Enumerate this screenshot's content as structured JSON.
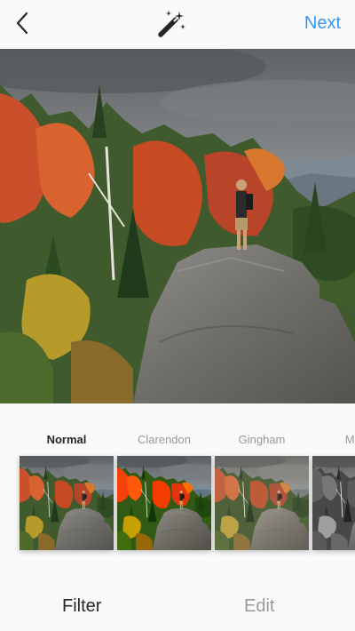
{
  "header": {
    "back_icon": "chevron-left-icon",
    "lux_icon": "magic-wand-icon",
    "next_label": "Next",
    "accent": "#3897f0"
  },
  "filters": [
    {
      "label": "Normal",
      "selected": true
    },
    {
      "label": "Clarendon",
      "selected": false
    },
    {
      "label": "Gingham",
      "selected": false
    },
    {
      "label": "Moon",
      "selected": false
    }
  ],
  "tabs": {
    "filter_label": "Filter",
    "edit_label": "Edit"
  }
}
